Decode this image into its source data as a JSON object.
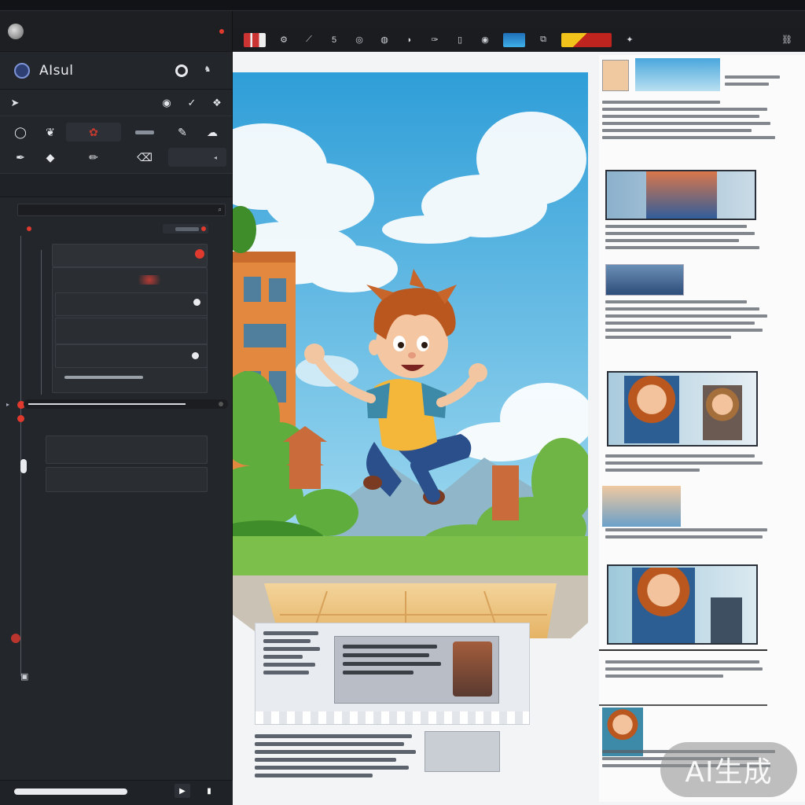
{
  "app": {
    "window_title": "",
    "panel_title": ""
  },
  "menubar": {
    "items": [
      "",
      "",
      "",
      "",
      "",
      "",
      "",
      ""
    ],
    "right": [
      "",
      "",
      ""
    ]
  },
  "toolbar": {
    "label": ""
  },
  "brand": {
    "name": "AIsul",
    "sub_label": ""
  },
  "tools": {
    "row1_label": "",
    "grid_wide_label": ""
  },
  "tabs": [
    "",
    "",
    "",
    "",
    "",
    ""
  ],
  "layers": {
    "search_value": "",
    "section_title": "",
    "section_subtitle": "",
    "items": [
      {
        "label": "",
        "sub": ""
      },
      {
        "label": "",
        "sub": ""
      },
      {
        "label": "",
        "sub": ""
      },
      {
        "label": "",
        "sub": ""
      },
      {
        "label": "",
        "sub": ""
      }
    ],
    "group2_title": "",
    "group2_items": [
      {
        "label": "",
        "sub": ""
      },
      {
        "label": "",
        "sub": ""
      }
    ]
  },
  "transport": {
    "time": "",
    "footer": ""
  },
  "colors": {
    "accent_red": "#e0392e",
    "panel_bg": "#23262b",
    "canvas_bg": "#f3f4f6",
    "sky": "#4fb7e6"
  },
  "icons": [
    "logo-icon",
    "brand-icon",
    "ring-icon",
    "brush-icon",
    "pen-icon",
    "eraser-icon",
    "check-icon",
    "layer-icon",
    "play-icon",
    "stop-icon"
  ],
  "watermark": {
    "text": "AI生成"
  }
}
